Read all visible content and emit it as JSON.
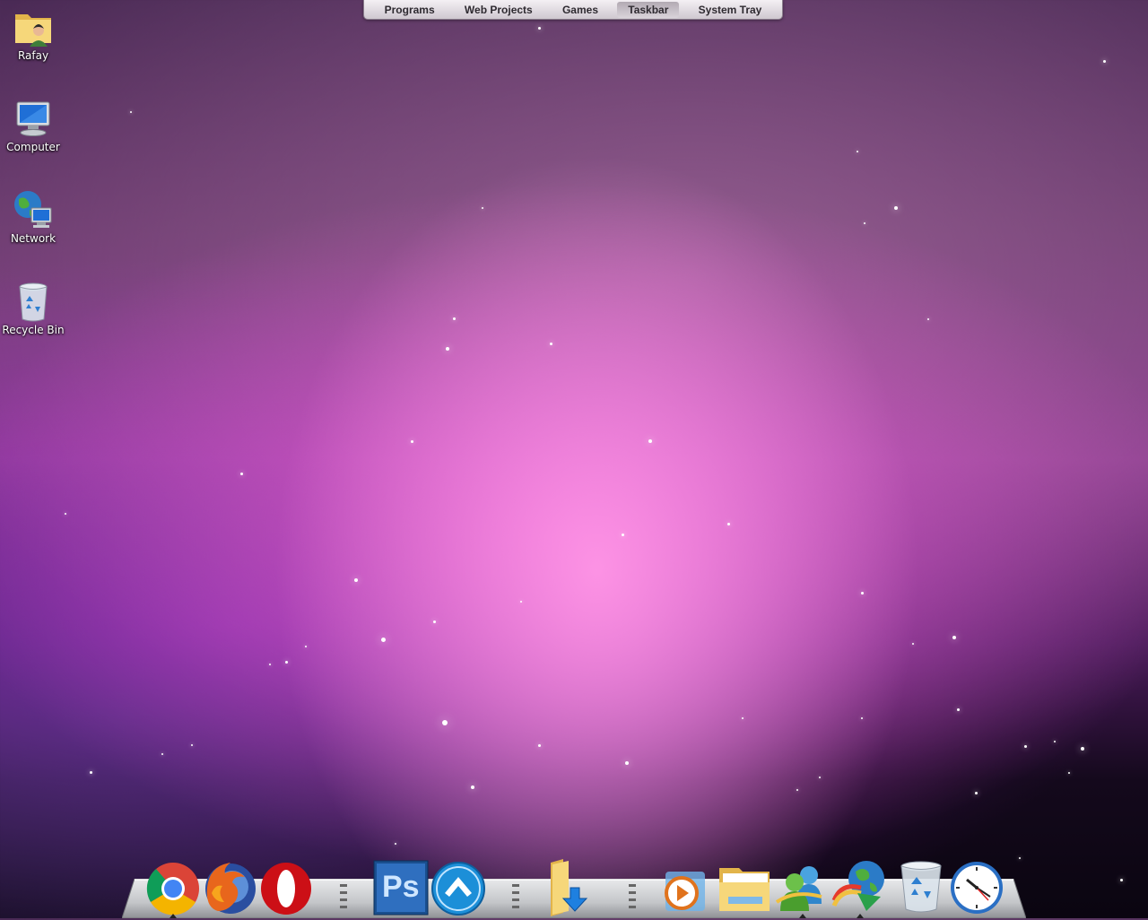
{
  "topbar": {
    "items": [
      {
        "label": "Programs",
        "active": false
      },
      {
        "label": "Web Projects",
        "active": false
      },
      {
        "label": "Games",
        "active": false
      },
      {
        "label": "Taskbar",
        "active": true
      },
      {
        "label": "System Tray",
        "active": false
      }
    ]
  },
  "desktop": {
    "icons": [
      {
        "label": "Rafay",
        "icon": "user-folder-icon"
      },
      {
        "label": "Computer",
        "icon": "computer-icon"
      },
      {
        "label": "Network",
        "icon": "network-icon"
      },
      {
        "label": "Recycle Bin",
        "icon": "recycle-bin-icon"
      }
    ]
  },
  "dock": {
    "items": [
      {
        "app": "chrome",
        "icon": "chrome-icon",
        "running": true
      },
      {
        "app": "firefox",
        "icon": "firefox-icon",
        "running": false
      },
      {
        "app": "opera",
        "icon": "opera-icon",
        "running": false
      },
      {
        "app": "photoshop",
        "icon": "photoshop-icon",
        "label": "Ps",
        "running": false
      },
      {
        "app": "filezilla",
        "icon": "transfer-app-icon",
        "running": false
      },
      {
        "app": "downloads",
        "icon": "downloads-folder-icon",
        "running": false
      },
      {
        "app": "media-player",
        "icon": "media-player-icon",
        "running": false
      },
      {
        "app": "explorer",
        "icon": "file-explorer-icon",
        "running": false
      },
      {
        "app": "messenger",
        "icon": "messenger-icon",
        "running": true
      },
      {
        "app": "internet-download-manager",
        "icon": "download-manager-icon",
        "running": true
      },
      {
        "app": "recycle-bin",
        "icon": "dock-recycle-bin-icon",
        "running": false
      },
      {
        "app": "clock",
        "icon": "clock-icon",
        "running": false
      }
    ]
  },
  "colors": {
    "menu_text": "#2e2a30",
    "label_text": "#ffffff",
    "photoshop_blue": "#1a4f8f"
  }
}
